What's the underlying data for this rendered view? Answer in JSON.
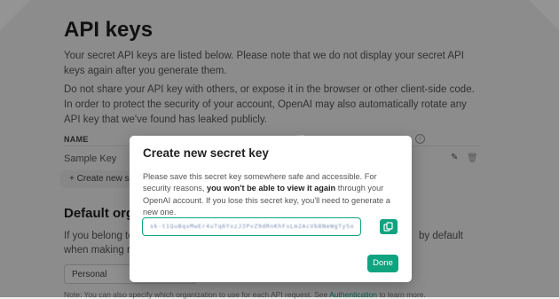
{
  "page": {
    "title": "API keys",
    "paragraph_1": "Your secret API keys are listed below. Please note that we do not display your secret API keys again after you generate them.",
    "paragraph_2": "Do not share your API key with others, or expose it in the browser or other client-side code. In order to protect the security of your account, OpenAI may also automatically rotate any API key that we've found has leaked publicly.",
    "table": {
      "column_name": "NAME",
      "rows": [
        {
          "name": "Sample Key"
        }
      ]
    },
    "create_button_label": "+ Create new secret key",
    "default_org": {
      "title": "Default organization",
      "text_left": "If you belong to",
      "text_right": "by default",
      "text_line2": "when making re",
      "selected": "Personal"
    },
    "note_prefix": "Note: You can also specify which organization to use for each API request. See",
    "note_link": "Authentication",
    "note_suffix": "to learn more."
  },
  "modal": {
    "title": "Create new secret key",
    "body_prefix": "Please save this secret key somewhere safe and accessible. For security reasons,",
    "body_bold": "you won't be able to view it again",
    "body_suffix": "through your OpenAI account. If you lose this secret key, you'll need to generate a new one.",
    "secret_value": "sk-t1QuBqxMwEr4uTq6YxzJ3PvZ9dRnKhFsLm2AcVb8NeWgTy5o",
    "done_label": "Done"
  },
  "colors": {
    "accent": "#10a37f",
    "overlay": "rgba(0,0,0,0.42)"
  },
  "icons": {
    "info": "info-circle-icon",
    "edit": "pencil-icon",
    "delete": "trash-icon",
    "copy": "copy-icon"
  }
}
